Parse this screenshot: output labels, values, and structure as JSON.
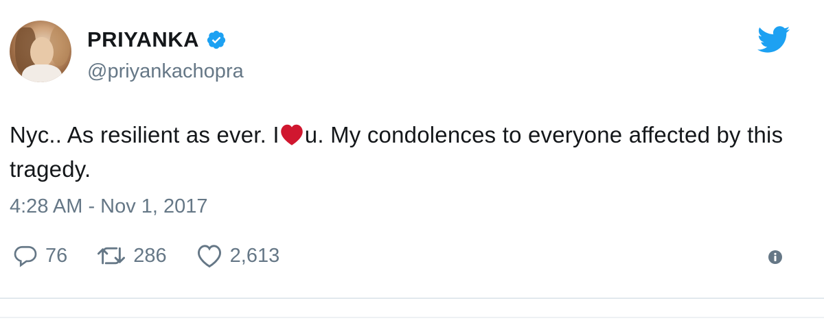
{
  "user": {
    "display_name": "PRIYANKA",
    "handle": "@priyankachopra",
    "verified": true
  },
  "tweet": {
    "text_before_heart": "Nyc.. As resilient as ever. I",
    "heart_emoji": "red-heart-emoji",
    "text_after_heart": "u. My condolences to everyone affected by this tragedy.",
    "timestamp": "4:28 AM - Nov 1, 2017"
  },
  "actions": {
    "replies": "76",
    "retweets": "286",
    "likes": "2,613"
  },
  "icons": {
    "brand": "twitter-bird-icon",
    "verified": "verified-badge-icon",
    "reply": "reply-icon",
    "retweet": "retweet-icon",
    "like": "heart-icon",
    "info": "info-icon"
  },
  "colors": {
    "brand_blue": "#1da1f2",
    "muted_text": "#657786",
    "body_text": "#14171a",
    "heart_red": "#d0172f"
  }
}
